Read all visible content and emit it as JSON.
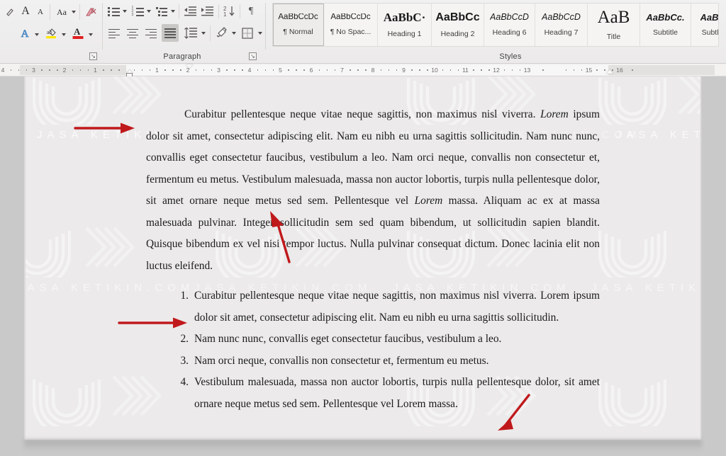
{
  "ribbon": {
    "groups": [
      {
        "label": "",
        "name": "font-group"
      },
      {
        "label": "Paragraph",
        "name": "paragraph-group"
      },
      {
        "label": "Styles",
        "name": "styles-group"
      }
    ],
    "font_group": {
      "label": "",
      "buttons": [
        {
          "name": "grow-font-icon",
          "glyph": "A",
          "size": 15
        },
        {
          "name": "shrink-font-icon",
          "glyph": "A",
          "size": 11
        },
        {
          "name": "change-case-icon",
          "glyph": "Aa",
          "size": 11
        },
        {
          "name": "clear-formatting-icon",
          "glyph": "",
          "size": 13
        },
        {
          "name": "text-effects-icon",
          "glyph": "A",
          "size": 14
        },
        {
          "name": "text-highlight-color-icon",
          "glyph": "ab",
          "size": 10
        },
        {
          "name": "font-color-icon",
          "glyph": "A",
          "size": 13
        }
      ]
    },
    "paragraph_group": {
      "label": "Paragraph",
      "buttons": [
        {
          "name": "bullets-icon"
        },
        {
          "name": "numbering-icon"
        },
        {
          "name": "multilevel-list-icon"
        },
        {
          "name": "decrease-indent-icon"
        },
        {
          "name": "increase-indent-icon"
        },
        {
          "name": "sort-icon"
        },
        {
          "name": "show-formatting-marks-icon"
        },
        {
          "name": "align-left-icon"
        },
        {
          "name": "align-center-icon"
        },
        {
          "name": "align-right-icon"
        },
        {
          "name": "justify-icon"
        },
        {
          "name": "line-spacing-icon"
        },
        {
          "name": "shading-icon"
        },
        {
          "name": "borders-icon"
        }
      ],
      "selected": "justify-icon"
    },
    "styles_group": {
      "label": "Styles",
      "items": [
        {
          "preview": "AaBbCcDc",
          "name": "¶ Normal",
          "font": "sans",
          "weight": "400",
          "style": "normal",
          "size": 11.5,
          "active": true
        },
        {
          "preview": "AaBbCcDc",
          "name": "¶ No Spac...",
          "font": "sans",
          "weight": "400",
          "style": "normal",
          "size": 11.5,
          "active": false
        },
        {
          "preview": "AaBbC·",
          "name": "Heading 1",
          "font": "serif",
          "weight": "700",
          "style": "normal",
          "size": 17,
          "active": false
        },
        {
          "preview": "AaBbCc",
          "name": "Heading 2",
          "font": "sans",
          "weight": "700",
          "style": "normal",
          "size": 16,
          "active": false
        },
        {
          "preview": "AaBbCcD",
          "name": "Heading 6",
          "font": "sans",
          "weight": "400",
          "style": "italic",
          "size": 12.5,
          "active": false
        },
        {
          "preview": "AaBbCcD",
          "name": "Heading 7",
          "font": "sans",
          "weight": "400",
          "style": "italic",
          "size": 12.5,
          "active": false
        },
        {
          "preview": "AaB",
          "name": "Title",
          "font": "serif",
          "weight": "400",
          "style": "normal",
          "size": 25,
          "active": false
        },
        {
          "preview": "AaBbCc.",
          "name": "Subtitle",
          "font": "sans",
          "weight": "700",
          "style": "italic",
          "size": 13,
          "active": false
        },
        {
          "preview": "AaBb",
          "name": "Subtle",
          "font": "sans",
          "weight": "700",
          "style": "italic",
          "size": 13,
          "active": false
        }
      ]
    }
  },
  "ruler": {
    "left_marks": [
      "4",
      "3",
      "2",
      "1"
    ],
    "right_marks": [
      "1",
      "2",
      "3",
      "4",
      "5",
      "6",
      "7",
      "8",
      "9",
      "10",
      "11",
      "12",
      "13",
      "15",
      "16"
    ]
  },
  "document": {
    "paragraph": {
      "line1": "Curabitur pellentesque neque vitae neque sagittis, non maximus nisl viverra.",
      "italic_lead": "Lorem",
      "body_part1": " ipsum dolor sit amet, consectetur adipiscing elit. Nam eu nibh eu urna sagittis sollicitudin. Nam nunc nunc, convallis eget consectetur faucibus, vestibulum a leo. Nam orci neque, convallis non consectetur et, fermentum eu metus. Vestibulum malesuada, massa non auctor lobortis, turpis nulla pellentesque dolor, sit amet ornare neque metus sed sem. Pellentesque vel ",
      "italic_mid": "Lorem",
      "body_part2": " massa. Aliquam ac ex at massa malesuada pulvinar. Integer sollicitudin sem sed quam bibendum, ut sollicitudin sapien blandit. Quisque bibendum ex vel nisi tempor luctus. Nulla pulvinar consequat dictum. Donec lacinia elit non luctus eleifend."
    },
    "list": [
      {
        "num": "1.",
        "line1": "Curabitur pellentesque neque vitae neque sagittis, non maximus nisl viverra.",
        "italic_lead": "Lorem",
        "rest": " ipsum dolor sit amet, consectetur adipiscing elit. Nam eu nibh eu urna sagittis sollicitudin."
      },
      {
        "num": "2.",
        "text": "Nam nunc nunc, convallis eget consectetur faucibus, vestibulum a leo."
      },
      {
        "num": "3.",
        "text": "Nam orci neque, convallis non consectetur et, fermentum eu metus."
      },
      {
        "num": "4.",
        "pre": "Vestibulum malesuada, massa non auctor lobortis, turpis nulla pellentesque dolor, sit amet ornare neque metus sed sem. Pellentesque vel ",
        "italic": "Lorem",
        "post": " massa."
      }
    ]
  },
  "watermark": {
    "text": "JASA KETIKIN.COM",
    "short": "JASA KETIKIN"
  },
  "colors": {
    "annotation_arrow": "#c0191c",
    "page_background": "#eceaea",
    "workspace_background": "#c9c9c9",
    "ribbon_background": "#f1f1f1",
    "text": "#1b1b1b",
    "highlight_yellow": "#ffe600",
    "font_color_red": "#e02020",
    "text_effects_blue": "#3f7fbf"
  }
}
